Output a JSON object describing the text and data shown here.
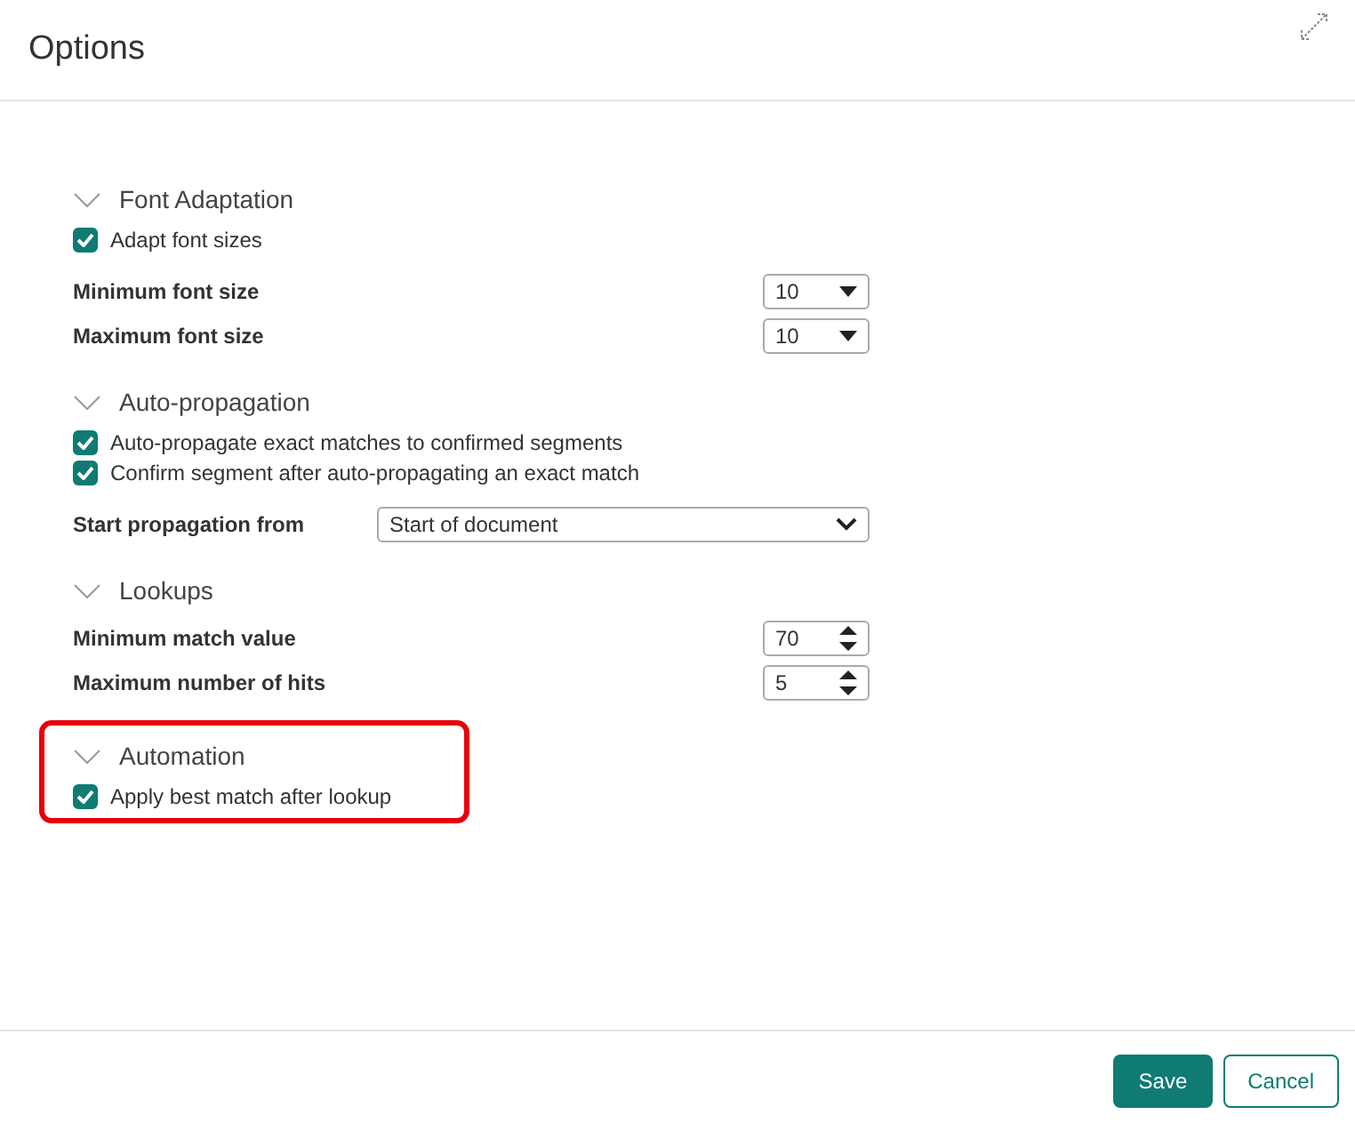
{
  "dialog": {
    "title": "Options"
  },
  "sections": [
    {
      "title": "Font Adaptation",
      "expanded": true,
      "highlighted": false,
      "items": [
        {
          "kind": "checkbox",
          "label": "Adapt font sizes",
          "checked": true
        },
        {
          "kind": "dropdown",
          "label": "Minimum font size",
          "value": "10"
        },
        {
          "kind": "dropdown",
          "label": "Maximum font size",
          "value": "10"
        }
      ]
    },
    {
      "title": "Auto-propagation",
      "expanded": true,
      "highlighted": false,
      "items": [
        {
          "kind": "checkbox",
          "label": "Auto-propagate exact matches to confirmed segments",
          "checked": true
        },
        {
          "kind": "checkbox",
          "label": "Confirm segment after auto-propagating an exact match",
          "checked": true
        },
        {
          "kind": "combo",
          "label": "Start propagation from",
          "value": "Start of document"
        }
      ]
    },
    {
      "title": "Lookups",
      "expanded": true,
      "highlighted": false,
      "items": [
        {
          "kind": "spinner",
          "label": "Minimum match value",
          "value": "70"
        },
        {
          "kind": "spinner",
          "label": "Maximum number of hits",
          "value": "5"
        }
      ]
    },
    {
      "title": "Automation",
      "expanded": true,
      "highlighted": true,
      "items": [
        {
          "kind": "checkbox",
          "label": "Apply best match after lookup",
          "checked": true
        }
      ]
    }
  ],
  "buttons": [
    {
      "label": "Save",
      "kind": "primary"
    },
    {
      "label": "Cancel",
      "kind": "secondary"
    }
  ]
}
